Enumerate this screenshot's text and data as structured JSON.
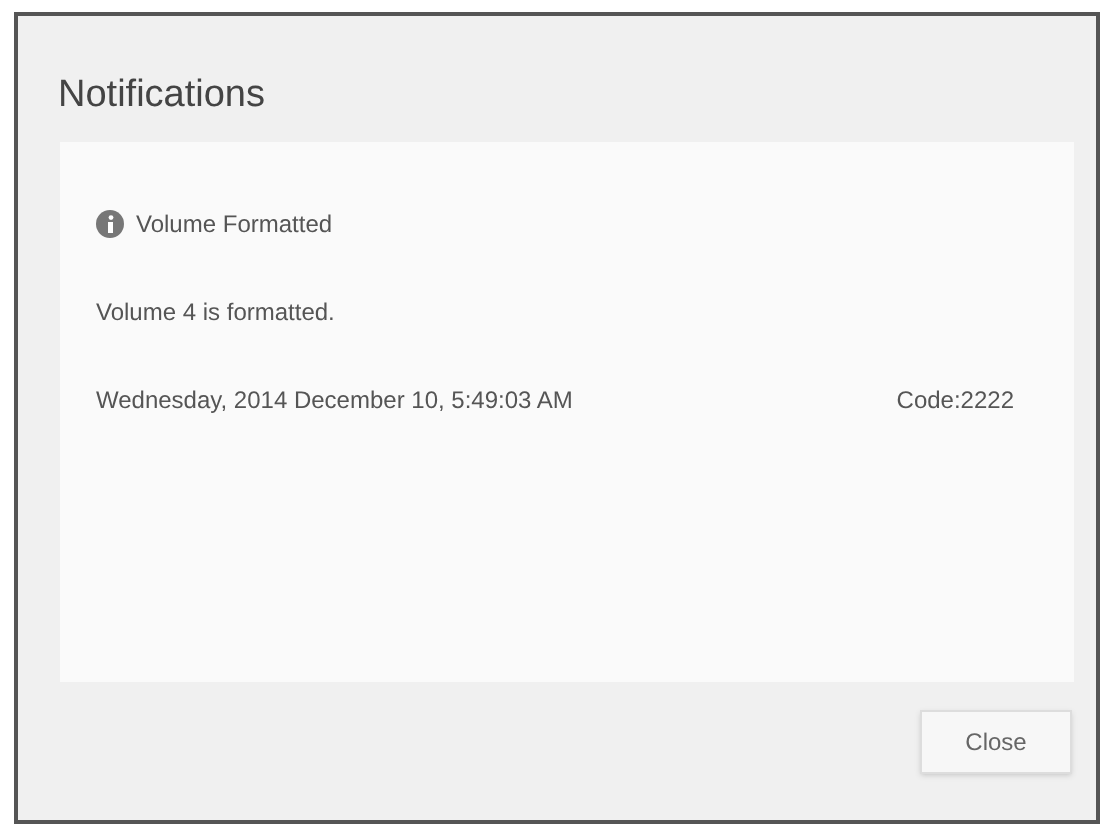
{
  "dialog": {
    "title": "Notifications"
  },
  "notification": {
    "heading": "Volume Formatted",
    "message": "Volume 4 is formatted.",
    "timestamp": "Wednesday, 2014 December 10, 5:49:03 AM",
    "code": "Code:2222"
  },
  "buttons": [
    "Close"
  ]
}
